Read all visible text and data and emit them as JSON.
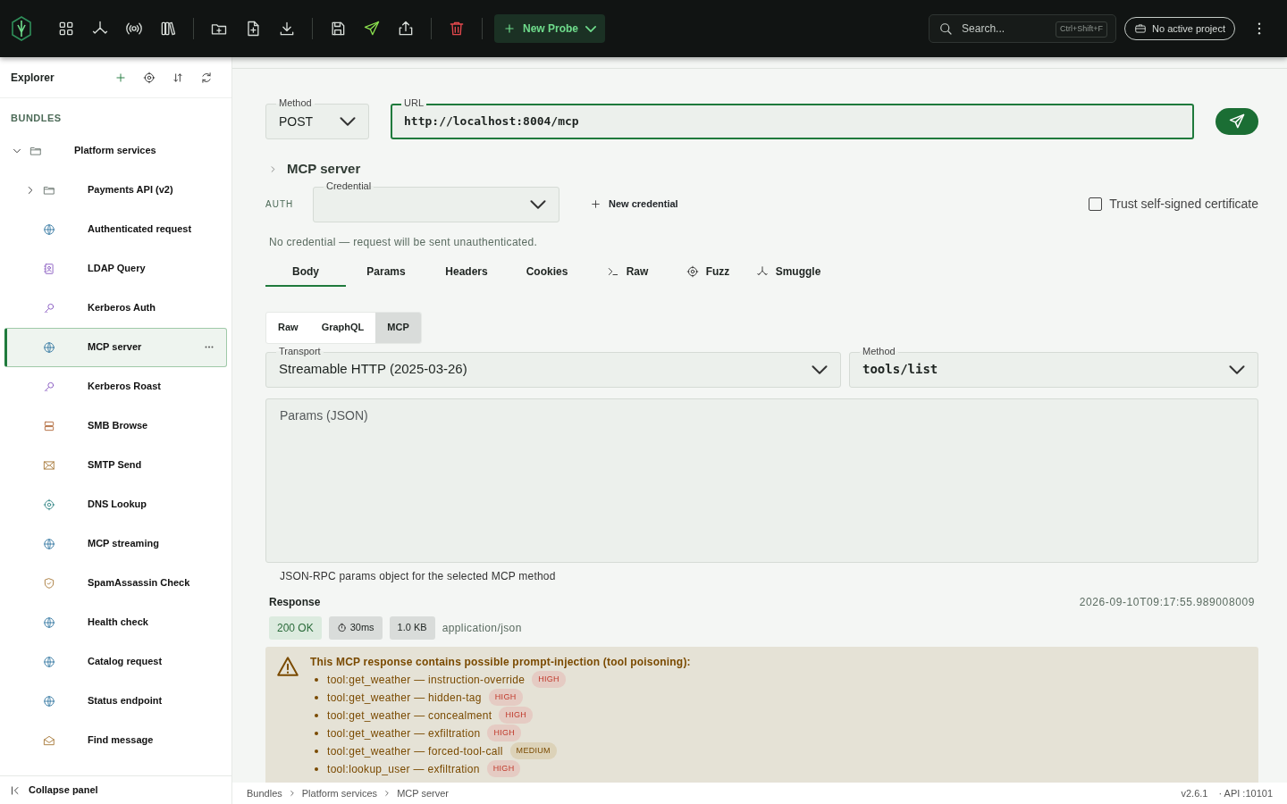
{
  "toolbar": {
    "new_probe": "New Probe",
    "search": {
      "placeholder": "Search...",
      "shortcut": "Ctrl+Shift+F"
    },
    "project": "No active project"
  },
  "explorer": {
    "title": "Explorer",
    "section": "BUNDLES",
    "collapse": "Collapse panel",
    "tree": [
      {
        "label": "Platform services",
        "kind": "folder",
        "expanded": true,
        "selected": false,
        "children": [
          {
            "label": "Payments API (v2)",
            "kind": "folder",
            "expanded": false,
            "selected": false
          },
          {
            "label": "Authenticated request",
            "kind": "globe",
            "selected": false
          },
          {
            "label": "LDAP Query",
            "kind": "contact",
            "selected": false
          },
          {
            "label": "Kerberos Auth",
            "kind": "key",
            "selected": false
          },
          {
            "label": "MCP server",
            "kind": "globe",
            "selected": true
          },
          {
            "label": "Kerberos Roast",
            "kind": "key",
            "selected": false
          },
          {
            "label": "SMB Browse",
            "kind": "server",
            "selected": false
          },
          {
            "label": "SMTP Send",
            "kind": "mail",
            "selected": false
          },
          {
            "label": "DNS Lookup",
            "kind": "target",
            "selected": false
          },
          {
            "label": "MCP streaming",
            "kind": "globe",
            "selected": false
          },
          {
            "label": "SpamAssassin Check",
            "kind": "shield",
            "selected": false
          },
          {
            "label": "Health check",
            "kind": "globe",
            "selected": false
          },
          {
            "label": "Catalog request",
            "kind": "globe",
            "selected": false
          },
          {
            "label": "Status endpoint",
            "kind": "globe",
            "selected": false
          },
          {
            "label": "Find message",
            "kind": "mailopen",
            "selected": false
          }
        ]
      }
    ]
  },
  "request": {
    "method": {
      "label": "Method",
      "value": "POST"
    },
    "url": {
      "label": "URL",
      "value": "http://localhost:8004/mcp"
    },
    "name": "MCP server",
    "auth": {
      "label": "AUTH",
      "credential_label": "Credential",
      "new_credential": "New credential",
      "trust": {
        "label": "Trust self-signed certificate",
        "checked": false
      },
      "note": "No credential — request will be sent unauthenticated."
    },
    "tabs": [
      {
        "label": "Body",
        "kind": "plain",
        "selected": true
      },
      {
        "label": "Params",
        "kind": "plain",
        "selected": false
      },
      {
        "label": "Headers",
        "kind": "plain",
        "selected": false
      },
      {
        "label": "Cookies",
        "kind": "plain",
        "selected": false
      },
      {
        "label": "Raw",
        "kind": "terminal",
        "selected": false
      },
      {
        "label": "Fuzz",
        "kind": "target",
        "selected": false
      },
      {
        "label": "Smuggle",
        "kind": "split",
        "selected": false
      }
    ],
    "body_modes": [
      {
        "label": "Raw",
        "selected": false
      },
      {
        "label": "GraphQL",
        "selected": false
      },
      {
        "label": "MCP",
        "selected": true
      }
    ],
    "transport": {
      "label": "Transport",
      "value": "Streamable HTTP (2025-03-26)"
    },
    "mcp_method": {
      "label": "Method",
      "value": "tools/list"
    },
    "params": {
      "placeholder": "Params (JSON)",
      "hint": "JSON-RPC params object for the selected MCP method"
    }
  },
  "response": {
    "title": "Response",
    "timestamp": "2026-09-10T09:17:55.989008009",
    "status": "200 OK",
    "time": "30ms",
    "size": "1.0 KB",
    "content_type": "application/json",
    "warning": {
      "title": "This MCP response contains possible prompt-injection (tool poisoning):",
      "findings": [
        {
          "text": "tool:get_weather — instruction-override",
          "severity": "HIGH",
          "kind": "high"
        },
        {
          "text": "tool:get_weather — hidden-tag",
          "severity": "HIGH",
          "kind": "high"
        },
        {
          "text": "tool:get_weather — concealment",
          "severity": "HIGH",
          "kind": "high"
        },
        {
          "text": "tool:get_weather — exfiltration",
          "severity": "HIGH",
          "kind": "high"
        },
        {
          "text": "tool:get_weather — forced-tool-call",
          "severity": "MEDIUM",
          "kind": "medium"
        },
        {
          "text": "tool:lookup_user — exfiltration",
          "severity": "HIGH",
          "kind": "high"
        }
      ]
    }
  },
  "status_bar": {
    "breadcrumb": [
      "Bundles",
      "Platform services",
      "MCP server"
    ],
    "version": "v2.6.1",
    "api": "· API :10101"
  }
}
